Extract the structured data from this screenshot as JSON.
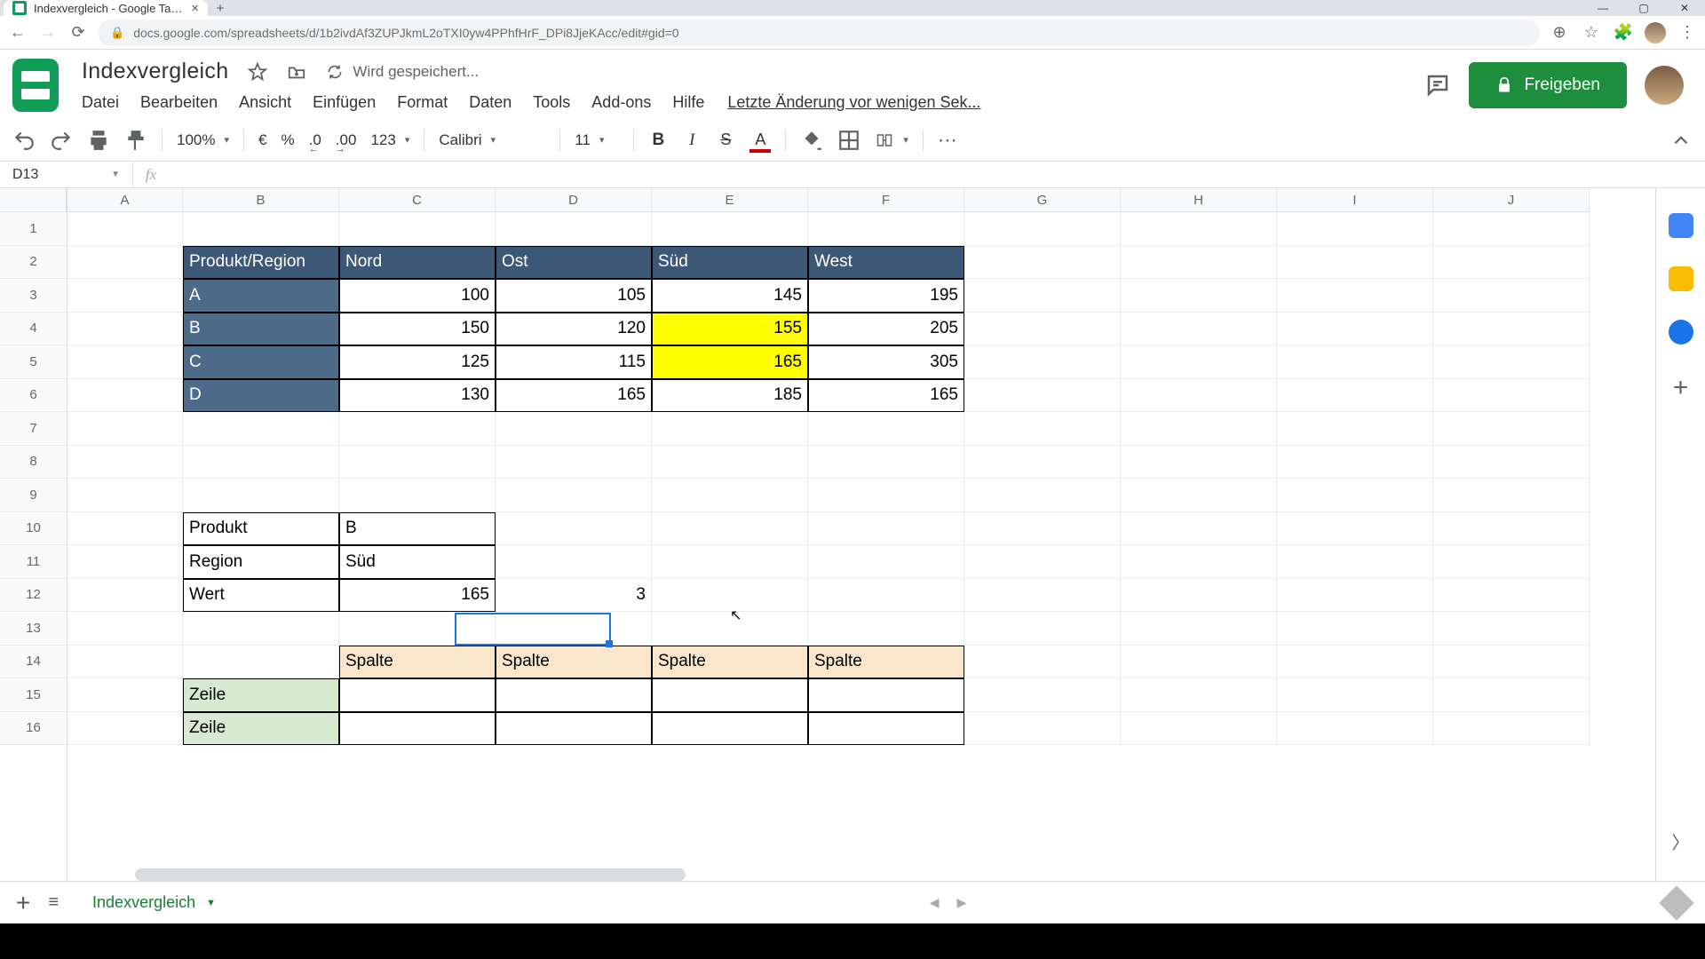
{
  "browser": {
    "tab_title": "Indexvergleich - Google Tabellen",
    "url": "docs.google.com/spreadsheets/d/1b2ivdAf3ZUPJkmL2oTXI0yw4PPhfHrF_DPi8JjeKAcc/edit#gid=0"
  },
  "doc": {
    "title": "Indexvergleich",
    "save_status": "Wird gespeichert...",
    "last_edit": "Letzte Änderung vor wenigen Sek...",
    "share_label": "Freigeben"
  },
  "menus": [
    "Datei",
    "Bearbeiten",
    "Ansicht",
    "Einfügen",
    "Format",
    "Daten",
    "Tools",
    "Add-ons",
    "Hilfe"
  ],
  "toolbar": {
    "zoom": "100%",
    "currency": "€",
    "percent": "%",
    "dec_less": ".0",
    "dec_more": ".00",
    "numfmt": "123",
    "font": "Calibri",
    "size": "11"
  },
  "fx": {
    "active_ref": "D13",
    "formula": ""
  },
  "columns": [
    "A",
    "B",
    "C",
    "D",
    "E",
    "F",
    "G",
    "H",
    "I",
    "J"
  ],
  "rows": [
    1,
    2,
    3,
    4,
    5,
    6,
    7,
    8,
    9,
    10,
    11,
    12,
    13,
    14,
    15,
    16
  ],
  "table1": {
    "headers": [
      "Produkt/Region",
      "Nord",
      "Ost",
      "Süd",
      "West"
    ],
    "rows": [
      {
        "label": "A",
        "v": [
          100,
          105,
          145,
          195
        ]
      },
      {
        "label": "B",
        "v": [
          150,
          120,
          155,
          205
        ]
      },
      {
        "label": "C",
        "v": [
          125,
          115,
          165,
          305
        ]
      },
      {
        "label": "D",
        "v": [
          130,
          165,
          185,
          165
        ]
      }
    ],
    "highlight": [
      [
        1,
        2
      ],
      [
        2,
        2
      ]
    ]
  },
  "lookup": {
    "labels": [
      "Produkt",
      "Region",
      "Wert"
    ],
    "values": [
      "B",
      "Süd",
      "165"
    ],
    "d12": "3"
  },
  "table2": {
    "col_label": "Spalte",
    "row_label": "Zeile"
  },
  "sheet_tab": "Indexvergleich",
  "chart_data": {
    "type": "table",
    "note": "No chart; spreadsheet tabular data",
    "table": [
      [
        "Produkt/Region",
        "Nord",
        "Ost",
        "Süd",
        "West"
      ],
      [
        "A",
        100,
        105,
        145,
        195
      ],
      [
        "B",
        150,
        120,
        155,
        205
      ],
      [
        "C",
        125,
        115,
        165,
        305
      ],
      [
        "D",
        130,
        165,
        185,
        165
      ]
    ]
  }
}
